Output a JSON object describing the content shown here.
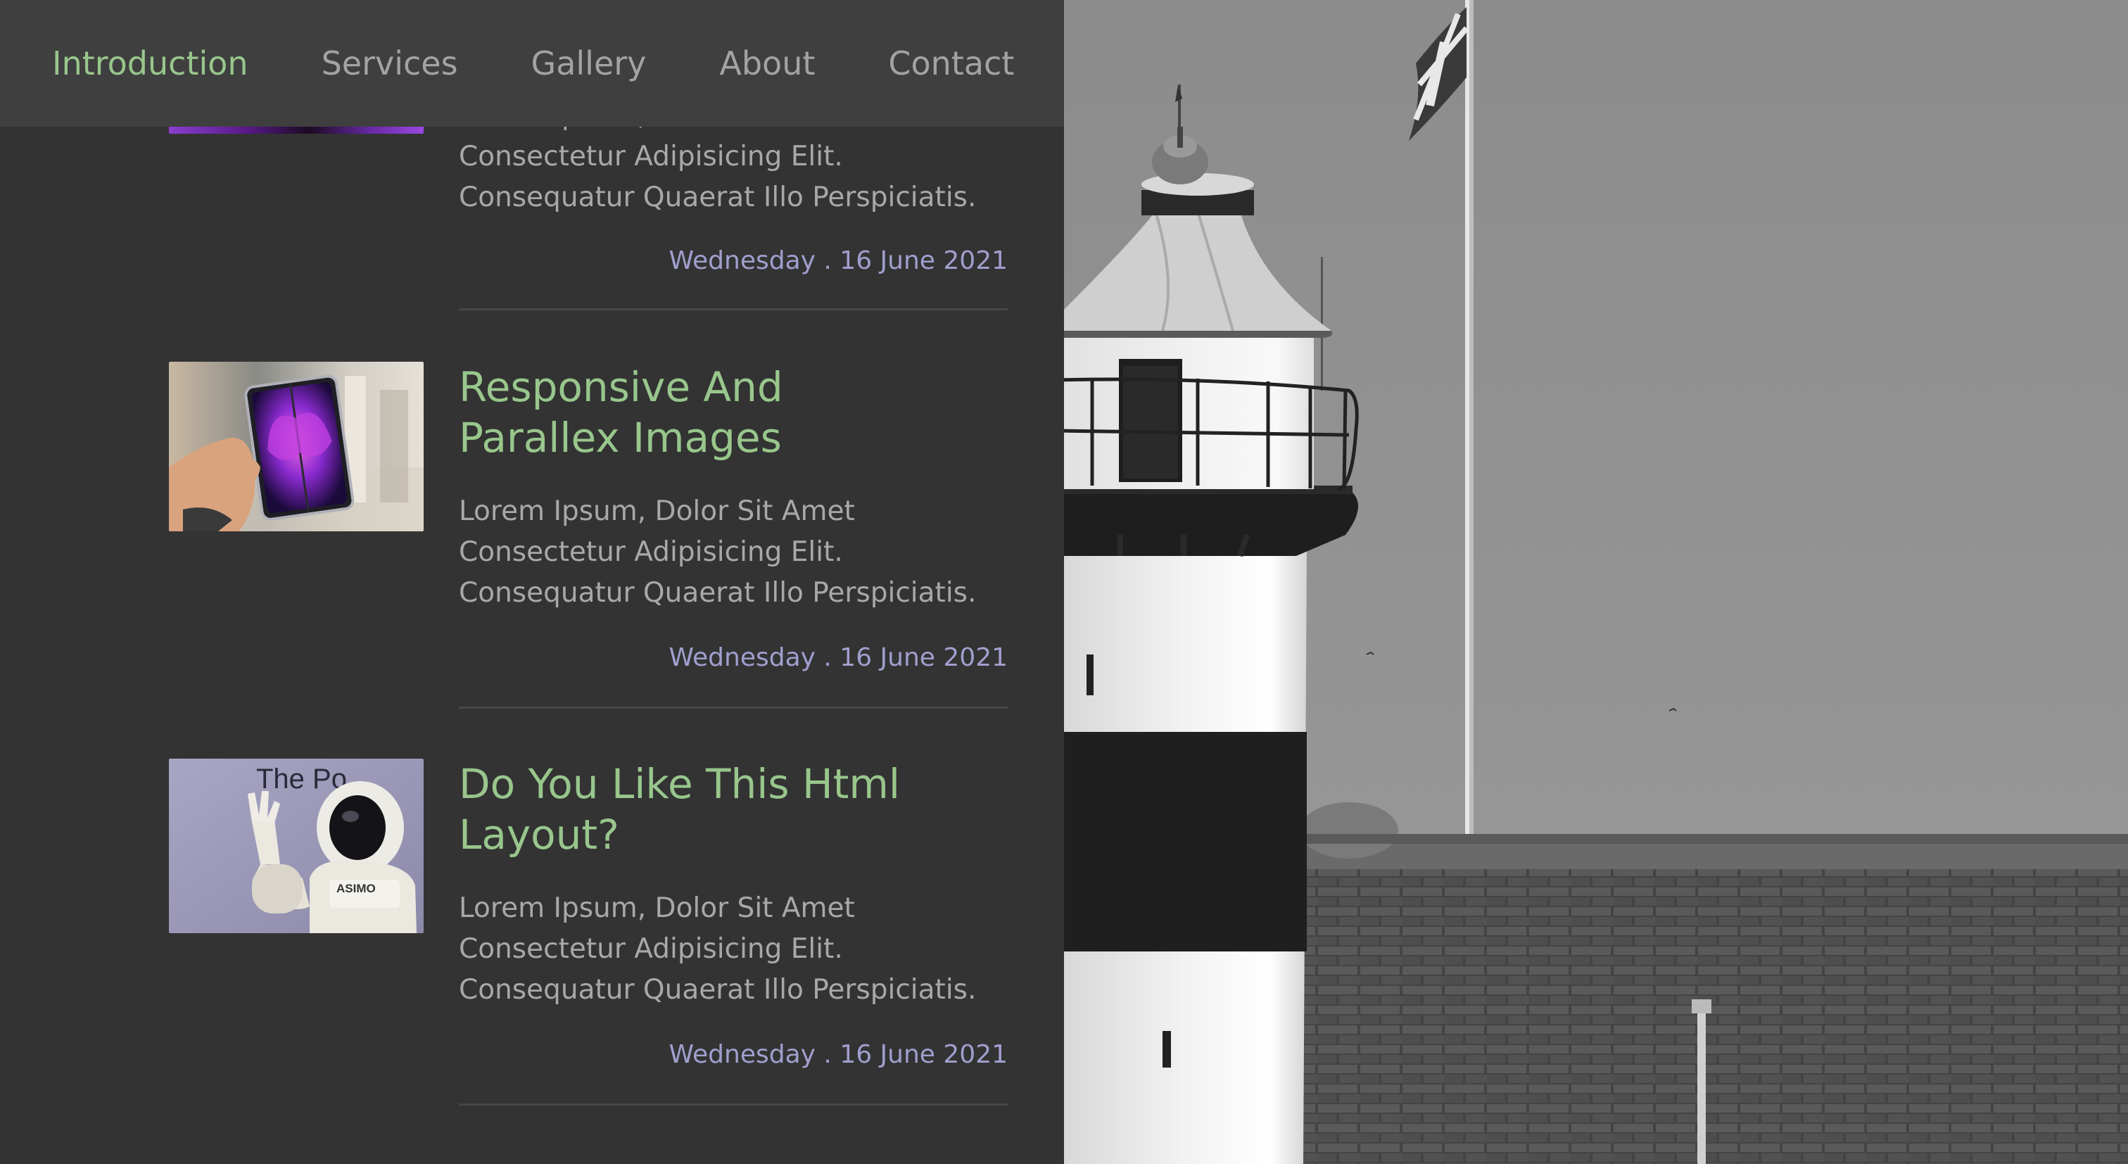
{
  "nav": {
    "items": [
      {
        "label": "Introduction",
        "active": true
      },
      {
        "label": "Services",
        "active": false
      },
      {
        "label": "Gallery",
        "active": false
      },
      {
        "label": "About",
        "active": false
      },
      {
        "label": "Contact",
        "active": false
      }
    ]
  },
  "posts": [
    {
      "image": "purple-gradient-image",
      "body_lines": [
        "Lorem Ipsum, Dolor Sit Amet",
        "Consectetur Adipisicing Elit.",
        "Consequatur Quaerat Illo Perspiciatis."
      ],
      "date": "Wednesday . 16 June 2021"
    },
    {
      "image": "foldable-phone-image",
      "title_lines": [
        "Responsive And",
        "Parallex Images"
      ],
      "body_lines": [
        "Lorem Ipsum, Dolor Sit Amet",
        "Consectetur Adipisicing Elit.",
        "Consequatur Quaerat Illo Perspiciatis."
      ],
      "date": "Wednesday . 16 June 2021"
    },
    {
      "image": "asimo-robot-image",
      "image_text": {
        "headline": "The Po",
        "robot_label": "ASIMO"
      },
      "title_lines": [
        "Do You Like This Html",
        "Layout?"
      ],
      "body_lines": [
        "Lorem Ipsum, Dolor Sit Amet",
        "Consectetur Adipisicing Elit.",
        "Consequatur Quaerat Illo Perspiciatis."
      ],
      "date": "Wednesday . 16 June 2021"
    }
  ],
  "hero": {
    "image": "lighthouse-flag-photo"
  },
  "colors": {
    "accent_green": "#98c68c",
    "date_lavender": "#a09fce",
    "panel_bg": "#333333",
    "nav_bg": "#3f3f3f",
    "text_muted": "#a8a8a8"
  }
}
